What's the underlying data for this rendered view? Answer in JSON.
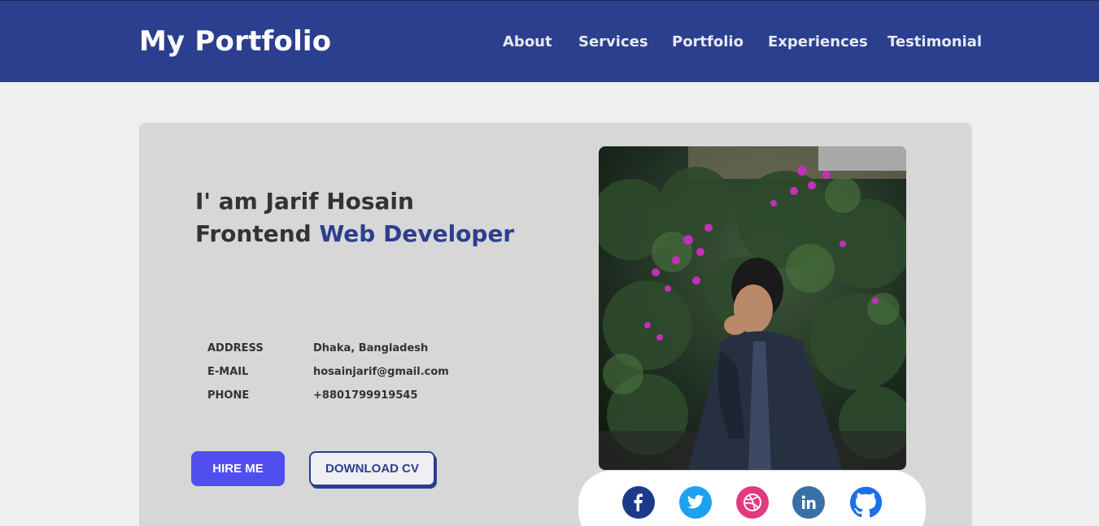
{
  "header": {
    "brand": "My Portfolio",
    "nav": [
      "About",
      "Services",
      "Portfolio",
      "Experiences",
      "Testimonial"
    ]
  },
  "hero": {
    "intro": "I' am Jarif Hosain",
    "role_prefix": "Frontend",
    "role_accent": "Web Developer",
    "info": [
      {
        "label": "ADDRESS",
        "value": "Dhaka, Bangladesh"
      },
      {
        "label": "E-MAIL",
        "value": "hosainjarif@gmail.com"
      },
      {
        "label": "PHONE",
        "value": "+8801799919545"
      }
    ],
    "hire_label": "HIRE ME",
    "cv_label": "DOWNLOAD CV"
  },
  "social": [
    {
      "icon": "facebook-icon",
      "color": "#1b3b8a"
    },
    {
      "icon": "twitter-icon",
      "color": "#1da1f2"
    },
    {
      "icon": "dribbble-icon",
      "color": "#e23a7f"
    },
    {
      "icon": "linkedin-icon",
      "color": "#3a70a8"
    },
    {
      "icon": "github-icon",
      "color": "#1f6feb"
    }
  ],
  "colors": {
    "navbar": "#2b3f8e",
    "accent": "#2b3f8e",
    "hire_button": "#514ef0",
    "card": "#d7d7d7",
    "page": "#efefef"
  }
}
